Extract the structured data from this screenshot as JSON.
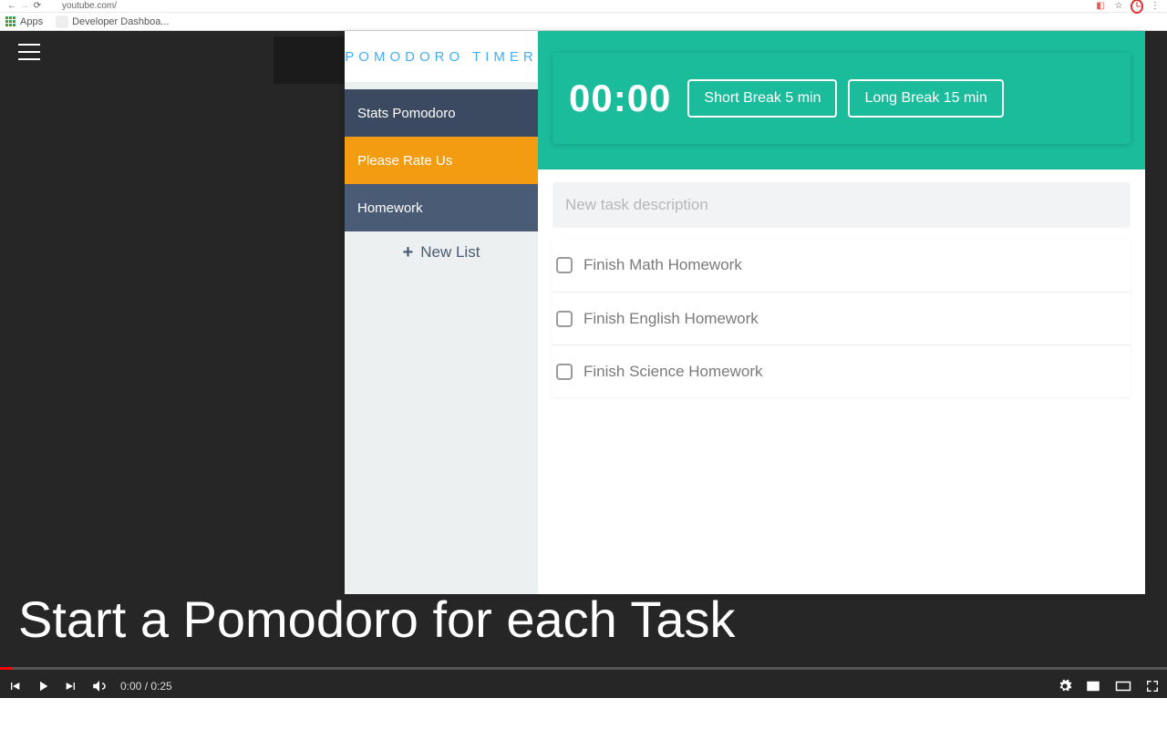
{
  "chrome": {
    "url": "youtube.com/",
    "bookmarks": {
      "apps": "Apps",
      "dev": "Developer Dashboa..."
    }
  },
  "youtube": {
    "caption": "Start a Pomodoro for each Task",
    "time_played": "0:00",
    "time_total": "0:25"
  },
  "ext": {
    "title": "POMODORO TIMER",
    "nav": {
      "stats": "Stats Pomodoro",
      "rate": "Please Rate Us",
      "list_active": "Homework",
      "new_list": "New List"
    },
    "timer": {
      "value": "00:00",
      "short_break": "Short Break 5 min",
      "long_break": "Long Break 15 min"
    },
    "newtask_placeholder": "New task description",
    "tasks": [
      "Finish Math Homework",
      "Finish English Homework",
      "Finish Science Homework"
    ]
  }
}
